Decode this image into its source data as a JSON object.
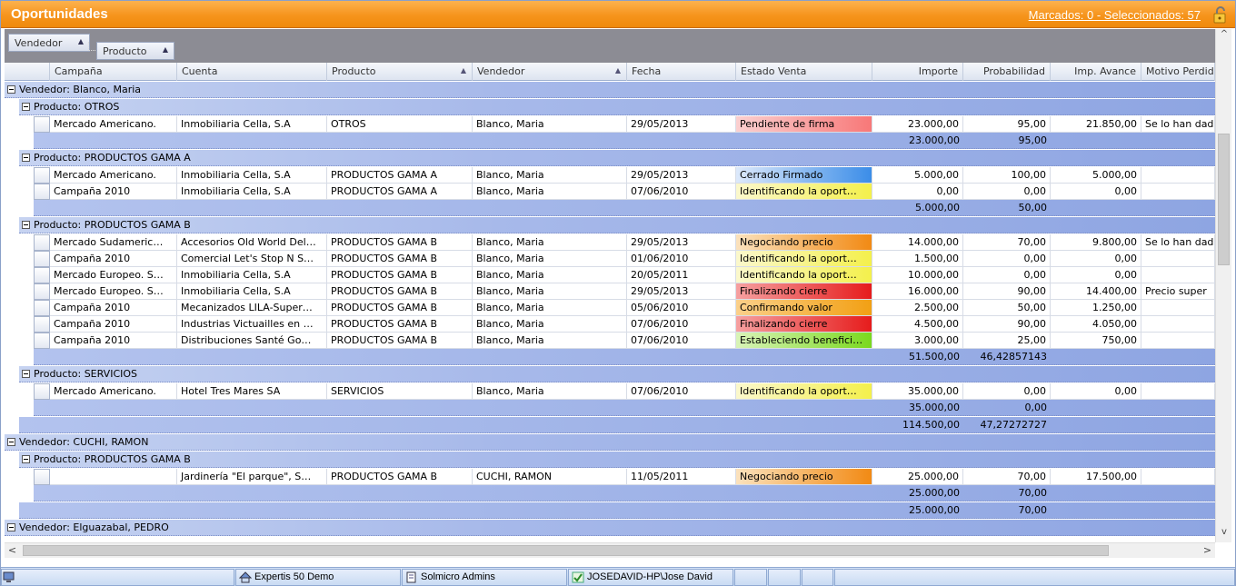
{
  "title": "Oportunidades",
  "counts": "Marcados: 0 - Seleccionados:  57",
  "group_by": [
    "Vendedor",
    "Producto"
  ],
  "columns": [
    "Campaña",
    "Cuenta",
    "Producto",
    "Vendedor",
    "Fecha",
    "Estado Venta",
    "Importe",
    "Probabilidad",
    "Imp. Avance",
    "Motivo Perdid"
  ],
  "groups": [
    {
      "vendedor_label": "Vendedor:  Blanco, Maria",
      "productos": [
        {
          "label": "Producto:  OTROS",
          "rows": [
            {
              "campana": "Mercado Americano.",
              "cuenta": "Inmobiliaria Cella, S.A",
              "producto": "OTROS",
              "vendedor": "Blanco, Maria",
              "fecha": "29/05/2013",
              "estado": "Pendiente de firma",
              "estado_color": "pink",
              "importe": "23.000,00",
              "prob": "95,00",
              "avance": "21.850,00",
              "motivo": "Se lo han dad"
            }
          ],
          "sum_importe": "23.000,00",
          "sum_prob": "95,00"
        },
        {
          "label": "Producto:  PRODUCTOS GAMA A",
          "rows": [
            {
              "campana": "Mercado Americano.",
              "cuenta": "Inmobiliaria Cella, S.A",
              "producto": "PRODUCTOS GAMA A",
              "vendedor": "Blanco, Maria",
              "fecha": "29/05/2013",
              "estado": "Cerrado Firmado",
              "estado_color": "blue",
              "importe": "5.000,00",
              "prob": "100,00",
              "avance": "5.000,00",
              "motivo": ""
            },
            {
              "campana": "Campaña 2010",
              "cuenta": "Inmobiliaria Cella, S.A",
              "producto": "PRODUCTOS GAMA A",
              "vendedor": "Blanco, Maria",
              "fecha": "07/06/2010",
              "estado": "Identificando la oport…",
              "estado_color": "yellow",
              "importe": "0,00",
              "prob": "0,00",
              "avance": "0,00",
              "motivo": ""
            }
          ],
          "sum_importe": "5.000,00",
          "sum_prob": "50,00"
        },
        {
          "label": "Producto:  PRODUCTOS GAMA B",
          "rows": [
            {
              "campana": "Mercado Sudameric…",
              "cuenta": "Accesorios Old World Del…",
              "producto": "PRODUCTOS GAMA B",
              "vendedor": "Blanco, Maria",
              "fecha": "29/05/2013",
              "estado": "Negociando precio",
              "estado_color": "orange",
              "importe": "14.000,00",
              "prob": "70,00",
              "avance": "9.800,00",
              "motivo": "Se lo han dad"
            },
            {
              "campana": "Campaña 2010",
              "cuenta": "Comercial Let's Stop N S…",
              "producto": "PRODUCTOS GAMA B",
              "vendedor": "Blanco, Maria",
              "fecha": "01/06/2010",
              "estado": "Identificando la oport…",
              "estado_color": "yellow",
              "importe": "1.500,00",
              "prob": "0,00",
              "avance": "0,00",
              "motivo": ""
            },
            {
              "campana": "Mercado Europeo. S…",
              "cuenta": "Inmobiliaria Cella, S.A",
              "producto": "PRODUCTOS GAMA B",
              "vendedor": "Blanco, Maria",
              "fecha": "20/05/2011",
              "estado": "Identificando la oport…",
              "estado_color": "yellow",
              "importe": "10.000,00",
              "prob": "0,00",
              "avance": "0,00",
              "motivo": ""
            },
            {
              "campana": "Mercado Europeo. S…",
              "cuenta": "Inmobiliaria Cella, S.A",
              "producto": "PRODUCTOS GAMA B",
              "vendedor": "Blanco, Maria",
              "fecha": "29/05/2013",
              "estado": "Finalizando cierre",
              "estado_color": "red",
              "importe": "16.000,00",
              "prob": "90,00",
              "avance": "14.400,00",
              "motivo": "Precio  super"
            },
            {
              "campana": "Campaña 2010",
              "cuenta": "Mecanizados LILA-Super…",
              "producto": "PRODUCTOS GAMA B",
              "vendedor": "Blanco, Maria",
              "fecha": "05/06/2010",
              "estado": "Confirmando valor",
              "estado_color": "orange2",
              "importe": "2.500,00",
              "prob": "50,00",
              "avance": "1.250,00",
              "motivo": ""
            },
            {
              "campana": "Campaña 2010",
              "cuenta": "Industrias Victuailles en …",
              "producto": "PRODUCTOS GAMA B",
              "vendedor": "Blanco, Maria",
              "fecha": "07/06/2010",
              "estado": "Finalizando cierre",
              "estado_color": "red",
              "importe": "4.500,00",
              "prob": "90,00",
              "avance": "4.050,00",
              "motivo": ""
            },
            {
              "campana": "Campaña 2010",
              "cuenta": "Distribuciones Santé Go…",
              "producto": "PRODUCTOS GAMA B",
              "vendedor": "Blanco, Maria",
              "fecha": "07/06/2010",
              "estado": "Estableciendo benefici…",
              "estado_color": "green",
              "importe": "3.000,00",
              "prob": "25,00",
              "avance": "750,00",
              "motivo": ""
            }
          ],
          "sum_importe": "51.500,00",
          "sum_prob": "46,42857143"
        },
        {
          "label": "Producto:  SERVICIOS",
          "rows": [
            {
              "campana": "Mercado Americano.",
              "cuenta": "Hotel Tres Mares SA",
              "producto": "SERVICIOS",
              "vendedor": "Blanco, Maria",
              "fecha": "07/06/2010",
              "estado": "Identificando la oport…",
              "estado_color": "yellow",
              "importe": "35.000,00",
              "prob": "0,00",
              "avance": "0,00",
              "motivo": ""
            }
          ],
          "sum_importe": "35.000,00",
          "sum_prob": "0,00"
        }
      ],
      "total_importe": "114.500,00",
      "total_prob": "47,27272727"
    },
    {
      "vendedor_label": "Vendedor:  CUCHI, RAMON",
      "productos": [
        {
          "label": "Producto:  PRODUCTOS GAMA B",
          "rows": [
            {
              "campana": "",
              "cuenta": "Jardinería \"El parque\", S…",
              "producto": "PRODUCTOS GAMA B",
              "vendedor": "CUCHI, RAMON",
              "fecha": "11/05/2011",
              "estado": "Negociando precio",
              "estado_color": "orange",
              "importe": "25.000,00",
              "prob": "70,00",
              "avance": "17.500,00",
              "motivo": ""
            }
          ],
          "sum_importe": "25.000,00",
          "sum_prob": "70,00"
        }
      ],
      "total_importe": "25.000,00",
      "total_prob": "70,00"
    },
    {
      "vendedor_label": "Vendedor:  Elguazabal, PEDRO",
      "productos": []
    }
  ],
  "status": {
    "db": "Expertis 50 Demo",
    "role": "Solmicro Admins",
    "user": "JOSEDAVID-HP\\Jose David"
  },
  "colors": {
    "title_orange": "#f6941c",
    "group_blue": "#8ea5e2",
    "state_pink": "#f87878",
    "state_blue": "#3b8de8",
    "state_yellow": "#f4f04c",
    "state_orange": "#f28a14",
    "state_red": "#e61c1c",
    "state_green": "#7ad81e"
  }
}
